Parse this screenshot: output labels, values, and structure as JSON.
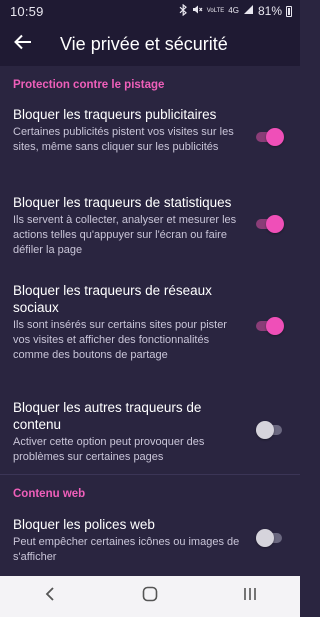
{
  "status_bar": {
    "time": "10:59",
    "icons": [
      "bluetooth-icon",
      "mute-icon",
      "volte-icon",
      "lte-icon",
      "signal-icon"
    ],
    "volte_label": "VoLTE",
    "network_label": "4G",
    "battery_percent": "81%",
    "battery_level": 0.81
  },
  "app_bar": {
    "back_icon": "arrow-left-icon",
    "title": "Vie privée et sécurité"
  },
  "sections": [
    {
      "header": "Protection contre le pistage",
      "items": [
        {
          "title": "Bloquer les traqueurs publicitaires",
          "description": "Certaines publicités pistent vos visites sur les sites, même sans cliquer sur les publicités",
          "enabled": true
        },
        {
          "title": "Bloquer les traqueurs de statistiques",
          "description": "Ils servent à collecter, analyser et mesurer les actions telles qu'appuyer sur l'écran ou faire défiler la page",
          "enabled": true
        },
        {
          "title": "Bloquer les traqueurs de réseaux sociaux",
          "description": "Ils sont insérés sur certains sites pour pister vos visites et afficher des fonctionnalités comme des boutons de partage",
          "enabled": true
        },
        {
          "title": "Bloquer les autres traqueurs de contenu",
          "description": "Activer cette option peut provoquer des problèmes sur certaines pages",
          "enabled": false
        }
      ]
    },
    {
      "header": "Contenu web",
      "items": [
        {
          "title": "Bloquer les polices web",
          "description": "Peut empêcher certaines icônes ou images de s'afficher",
          "enabled": false
        }
      ]
    }
  ],
  "nav_bar": {
    "buttons": [
      "back-nav-icon",
      "home-nav-icon",
      "recents-nav-icon"
    ]
  },
  "colors": {
    "background": "#2a2540",
    "bar": "#1f1a33",
    "accent": "#ef4fb8",
    "section_header": "#ef5fba"
  }
}
